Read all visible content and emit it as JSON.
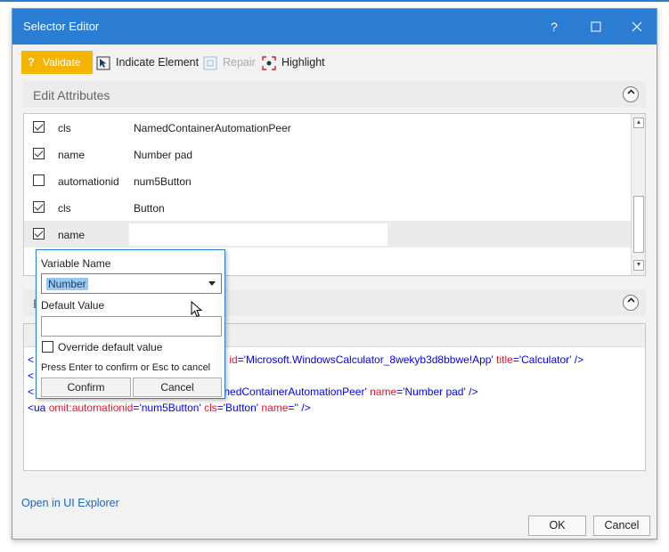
{
  "window": {
    "title": "Selector Editor",
    "help_label": "?"
  },
  "toolbar": {
    "validate_label": "Validate",
    "indicate_label": "Indicate Element",
    "repair_label": "Repair",
    "highlight_label": "Highlight"
  },
  "edit_attributes": {
    "header": "Edit Attributes",
    "rows": [
      {
        "checked": true,
        "name": "cls",
        "value": "NamedContainerAutomationPeer"
      },
      {
        "checked": true,
        "name": "name",
        "value": "Number pad"
      },
      {
        "checked": false,
        "name": "automationid",
        "value": "num5Button"
      },
      {
        "checked": true,
        "name": "cls",
        "value": "Button"
      },
      {
        "checked": true,
        "name": "name",
        "value": ""
      }
    ]
  },
  "selector_section": {
    "header_partial": "E",
    "lines": [
      {
        "prefix": "<",
        "attr1": "id",
        "val1": "'Microsoft.WindowsCalculator_8wekyb3d8bbwe!App'",
        "attr2": "title",
        "val2": "'Calculator'",
        "suffix": " />"
      },
      {
        "prefix": "<",
        "attr1": "",
        "val1": "",
        "attr2": "",
        "val2": "",
        "suffix": ""
      },
      {
        "prefix": "<",
        "attr1": "",
        "val1": "nedContainerAutomationPeer'",
        "attr2": "name",
        "val2": "'Number pad'",
        "suffix": " />"
      },
      {
        "prefix": "<ua",
        "attr1": "omit:automationid",
        "val1": "'num5Button'",
        "attr2": "cls",
        "val2": "'Button'",
        "attr3": "name",
        "val3": "''",
        "suffix": " />"
      }
    ]
  },
  "popup": {
    "variable_name_label": "Variable Name",
    "variable_value": "Number",
    "default_value_label": "Default Value",
    "default_value": "",
    "override_label": "Override default value",
    "hint": "Press Enter to confirm or Esc to cancel",
    "confirm_label": "Confirm",
    "cancel_label": "Cancel"
  },
  "footer": {
    "open_explorer_label": "Open in UI Explorer",
    "ok_label": "OK",
    "cancel_label": "Cancel"
  },
  "colors": {
    "accent": "#2b7cd3",
    "validate": "#f5b400",
    "selector_attr": "#e0182e",
    "selector_value": "#0000ff"
  }
}
